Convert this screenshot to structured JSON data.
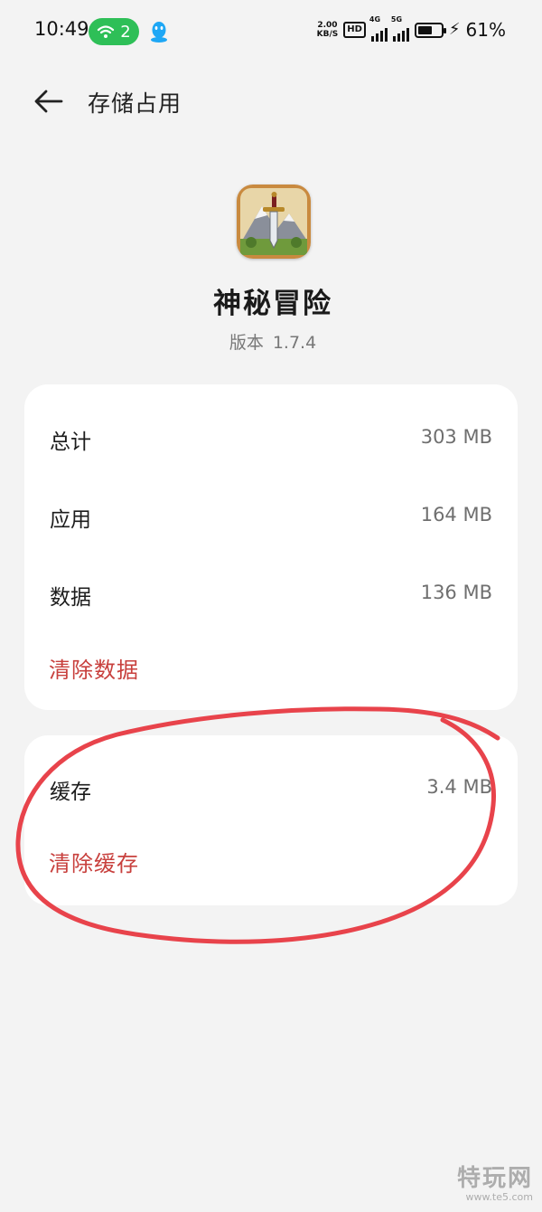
{
  "status_bar": {
    "time": "10:49",
    "wifi_count": "2",
    "netspeed_value": "2.00",
    "netspeed_unit": "KB/S",
    "hd_badge": "HD",
    "signal1_tag": "4G",
    "signal2_tag": "5G",
    "battery_percent": "61%",
    "battery_level": 0.61,
    "colors": {
      "wifi_pill": "#2ebf57",
      "qq_icon": "#1ea7f5"
    }
  },
  "header": {
    "title": "存储占用"
  },
  "app": {
    "name": "神秘冒险",
    "version_label": "版本",
    "version_value": "1.7.4"
  },
  "storage": {
    "rows": [
      {
        "label": "总计",
        "value": "303 MB"
      },
      {
        "label": "应用",
        "value": "164 MB"
      },
      {
        "label": "数据",
        "value": "136 MB"
      }
    ],
    "clear_data_label": "清除数据"
  },
  "cache": {
    "label": "缓存",
    "value": "3.4 MB",
    "clear_cache_label": "清除缓存"
  },
  "watermark": {
    "main": "特玩网",
    "url": "www.te5.com"
  },
  "accent_colors": {
    "danger": "#c8403d",
    "annotation": "#e8434b"
  }
}
